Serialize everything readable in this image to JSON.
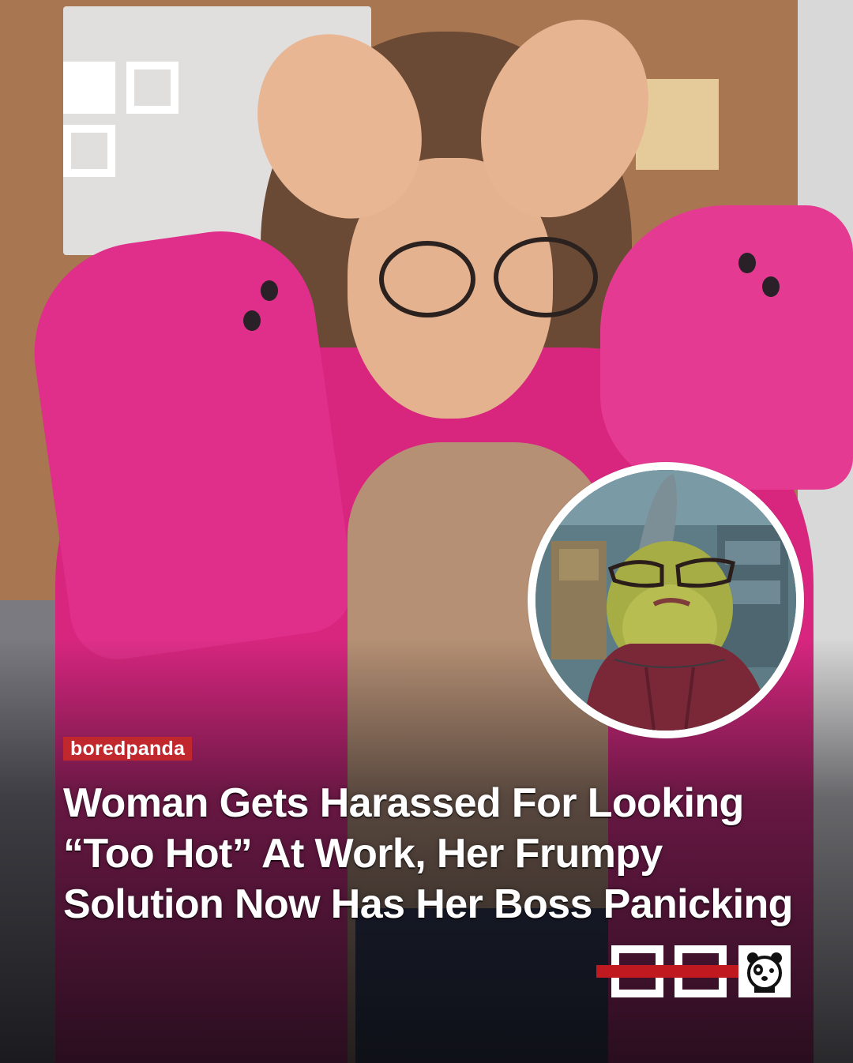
{
  "brand": {
    "tag_label": "boredpanda"
  },
  "headline": {
    "text": "Woman Gets Harassed For Looking “Too Hot” At Work, Her Frumpy Solution Now Has Her Boss Panicking"
  },
  "icons": {
    "top_left_logo": "squares-logo-icon",
    "bottom_right_logo": "boredpanda-logo-icon",
    "panda": "panda-face-icon"
  },
  "colors": {
    "brand_red": "#c0282e",
    "text": "#ffffff",
    "blazer_pink": "#d8267f"
  }
}
